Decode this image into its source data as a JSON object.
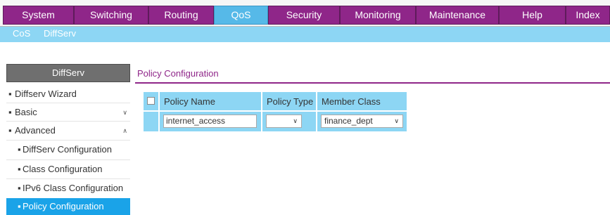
{
  "topnav": {
    "tabs": [
      {
        "label": "System"
      },
      {
        "label": "Switching"
      },
      {
        "label": "Routing"
      },
      {
        "label": "QoS"
      },
      {
        "label": "Security"
      },
      {
        "label": "Monitoring"
      },
      {
        "label": "Maintenance"
      },
      {
        "label": "Help"
      },
      {
        "label": "Index"
      }
    ],
    "active": "QoS"
  },
  "subnav": {
    "items": [
      {
        "label": "CoS"
      },
      {
        "label": "DiffServ"
      }
    ],
    "active": "DiffServ"
  },
  "sidebar": {
    "title": "DiffServ",
    "items": [
      {
        "label": "Diffserv Wizard"
      },
      {
        "label": "Basic",
        "icon": "chevron-down-icon"
      },
      {
        "label": "Advanced",
        "icon": "chevron-up-icon"
      },
      {
        "label": "DiffServ Configuration"
      },
      {
        "label": "Class Configuration"
      },
      {
        "label": "IPv6 Class Configuration"
      },
      {
        "label": "Policy Configuration"
      }
    ],
    "active": "Policy Configuration"
  },
  "content": {
    "section_title": "Policy Configuration",
    "table": {
      "headers": [
        "Policy Name",
        "Policy Type",
        "Member Class"
      ],
      "row": {
        "policy_name": "internet_access",
        "policy_type": "",
        "member_class": "finance_dept"
      }
    }
  },
  "colors": {
    "brand": "#8f2689",
    "active_tab": "#56b9e8",
    "subnav_bg": "#8dd6f4",
    "sidebar_active": "#1aa3e8",
    "table_bg": "#8dd6f4"
  }
}
